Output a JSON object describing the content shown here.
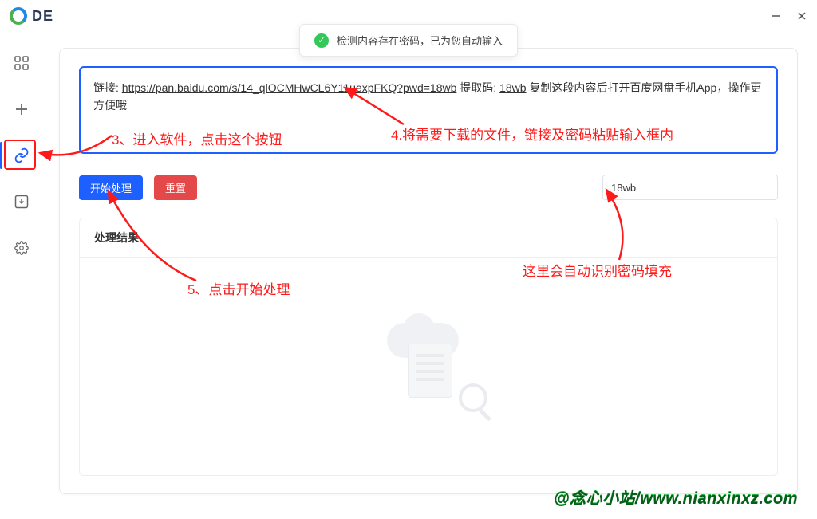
{
  "titlebar": {
    "app_name": "DE"
  },
  "toast": {
    "message": "检测内容存在密码，已为您自动输入"
  },
  "url_box": {
    "prefix": "链接: ",
    "url_part1": "https://pan.baidu.com",
    "url_part2": "/s/14_qlOCMHwCL6Y11uexpFKQ?pwd=",
    "url_part3": "18wb",
    "extract_label": " 提取码: ",
    "extract_code": "18wb",
    "suffix": " 复制这段内容后打开百度网盘手机App，操作更方便哦"
  },
  "buttons": {
    "start": "开始处理",
    "reset": "重置"
  },
  "password_field": {
    "value": "18wb"
  },
  "results": {
    "title": "处理结果"
  },
  "annotations": {
    "a3": "3、进入软件，点击这个按钮",
    "a4": "4.将需要下载的文件，链接及密码粘贴输入框内",
    "a5": "5、点击开始处理",
    "a6": "这里会自动识别密码填充"
  },
  "footer": {
    "brand": "@念心小站/www.nianxinxz.com"
  },
  "colors": {
    "primary": "#1e5fff",
    "danger": "#e54848",
    "anno": "#ff1a1a"
  }
}
